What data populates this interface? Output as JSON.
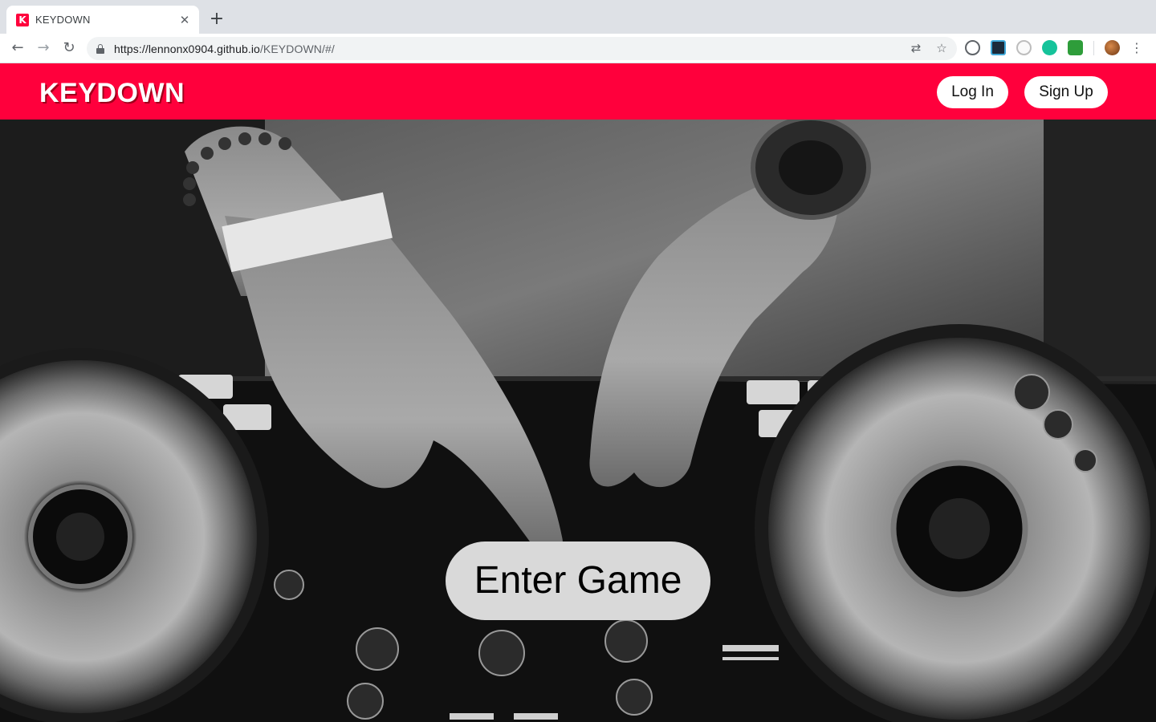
{
  "browser": {
    "tab": {
      "favicon_letter": "K",
      "title": "KEYDOWN",
      "close_glyph": "✕"
    },
    "new_tab_glyph": "+",
    "nav": {
      "back_glyph": "←",
      "forward_glyph": "→",
      "reload_glyph": "↻"
    },
    "url": {
      "host": "https://lennonx0904.github.io",
      "path": "/KEYDOWN/#/"
    },
    "omnibox_icons": {
      "translate_glyph": "⇄",
      "bookmark_glyph": "☆"
    },
    "menu_glyph": "⋮"
  },
  "header": {
    "brand": "KEYDOWN",
    "login_label": "Log In",
    "signup_label": "Sign Up",
    "accent_color": "#ff003c"
  },
  "hero": {
    "enter_label": "Enter Game"
  }
}
